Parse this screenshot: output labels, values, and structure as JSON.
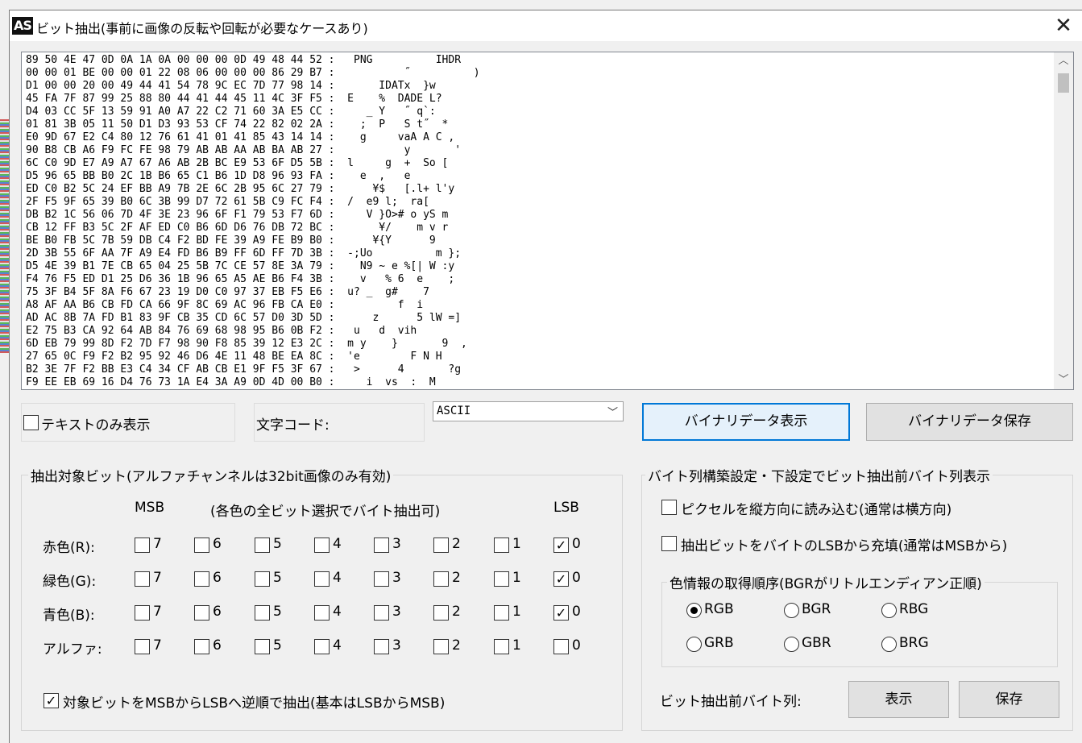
{
  "window": {
    "title": "ビット抽出(事前に画像の反転や回転が必要なケースあり)",
    "icon_text": "AS",
    "close": "✕"
  },
  "hex_lines": [
    "89 50 4E 47 0D 0A 1A 0A 00 00 00 0D 49 48 44 52 :   PNG          IHDR",
    "00 00 01 BE 00 00 01 22 08 06 00 00 00 86 29 B7 :           ˝          )",
    "D1 00 00 20 00 49 44 41 54 78 9C EC 7D 77 98 14 :       IDATx  }w",
    "45 FA 7F 87 99 25 88 80 44 41 44 45 11 4C 3F F5 :  E    %  DADE L?",
    "D4 03 CC 5F 13 59 91 A0 A7 22 C2 71 60 3A E5 CC :     _ Y   ˝ q`:",
    "01 81 3B 05 11 50 D1 D3 93 53 CF 74 22 82 02 2A :    ;  P   S t˝  *",
    "E0 9D 67 E2 C4 80 12 76 61 41 01 41 85 43 14 14 :    g     vaA A C ,",
    "90 B8 CB A6 F9 FC FE 98 79 AB AB AA AB BA AB 27 :           y       '",
    "6C C0 9D E7 A9 A7 67 A6 AB 2B BC E9 53 6F D5 5B :  l     g  +  So [",
    "D5 96 65 BB B0 2C 1B B6 65 C1 B6 1D D8 96 93 FA :    e  ,   e",
    "ED C0 B2 5C 24 EF BB A9 7B 2E 6C 2B 95 6C 27 79 :      ¥$   [.l+ l'y",
    "2F F5 9F 65 39 B0 6C 3B 99 D7 72 61 5B C9 FC F4 :  /  e9 l;  ra[",
    "DB B2 1C 56 06 7D 4F 3E 23 96 6F F1 79 53 F7 6D :     V }O># o yS m",
    "CB 12 FF B3 5C 2F AF ED C0 B6 6D D6 76 DB 72 BC :       ¥/    m v r",
    "BE B0 FB 5C 7B 59 DB C4 F2 BD FE 39 A9 FE B9 B0 :      ¥{Y      9",
    "2D 3B 55 6F AA 7F A9 E4 FD B6 B9 FF 6D FF 7D 3B :  -;Uo          m };",
    "D5 4E 39 B1 7E CB 65 04 25 5B 7C CE 57 8E 3A 79 :    N9 ~ e %[| W :y",
    "F4 76 F5 ED D1 25 D6 36 1B 96 65 A5 AE B6 F4 3B :    v   % 6  e    ;",
    "75 3F B4 5F 8A F6 67 23 19 D0 C0 97 37 EB F5 E6 :  u? _  g#    7",
    "A8 AF AA B6 CB FD CA 66 9F 8C 69 AC 96 FB CA E0 :          f  i",
    "AD AC 8B 7A FD B1 83 9F CB 35 CD 6C 57 D0 3D 5D :      z      5 lW =]",
    "E2 75 B3 CA 92 64 AB 84 76 69 68 98 95 B6 0B F2 :   u   d  vih",
    "6D EB 79 99 8D F2 7D F7 98 90 F8 85 39 12 E3 2C :  m y    }       9  ,",
    "27 65 0C F9 F2 B2 95 92 46 D6 4E 11 48 BE EA 8C :  'e        F N H",
    "B2 3E 7F F2 BB E3 C4 34 CF AB CB E1 9F F5 3F 67 :   >      4       ?g",
    "F9 EE EB 69 16 D4 76 73 1A E4 3A A9 0D 4D 00 B0 :     i  vs  :  M"
  ],
  "controls": {
    "text_only_label": "テキストのみ表示",
    "charcode_label": "文字コード:",
    "charcode_value": "ASCII",
    "show_binary_button": "バイナリデータ表示",
    "save_binary_button": "バイナリデータ保存"
  },
  "bits": {
    "group_title": "抽出対象ビット(アルファチャンネルは32bit画像のみ有効)",
    "msb_label": "MSB",
    "hint": "(各色の全ビット選択でバイト抽出可)",
    "lsb_label": "LSB",
    "bit_numbers": [
      "7",
      "6",
      "5",
      "4",
      "3",
      "2",
      "1",
      "0"
    ],
    "rows": [
      {
        "label": "赤色(R):",
        "checked": [
          false,
          false,
          false,
          false,
          false,
          false,
          false,
          true
        ]
      },
      {
        "label": "緑色(G):",
        "checked": [
          false,
          false,
          false,
          false,
          false,
          false,
          false,
          true
        ]
      },
      {
        "label": "青色(B):",
        "checked": [
          false,
          false,
          false,
          false,
          false,
          false,
          false,
          true
        ]
      },
      {
        "label": "アルファ:",
        "checked": [
          false,
          false,
          false,
          false,
          false,
          false,
          false,
          false
        ]
      }
    ],
    "reverse_label": "対象ビットをMSBからLSBへ逆順で抽出(基本はLSBからMSB)",
    "reverse_checked": true
  },
  "build": {
    "group_title": "バイト列構築設定・下設定でビット抽出前バイト列表示",
    "vertical_label": "ピクセルを縦方向に読み込む(通常は横方向)",
    "lsbfill_label": "抽出ビットをバイトのLSBから充填(通常はMSBから)",
    "order_title": "色情報の取得順序(BGRがリトルエンディアン正順)",
    "orders": [
      "RGB",
      "BGR",
      "RBG",
      "GRB",
      "GBR",
      "BRG"
    ],
    "selected_order": "RGB",
    "prebytes_label": "ビット抽出前バイト列:",
    "show_button": "表示",
    "save_button": "保存"
  },
  "check_mark": "✓"
}
